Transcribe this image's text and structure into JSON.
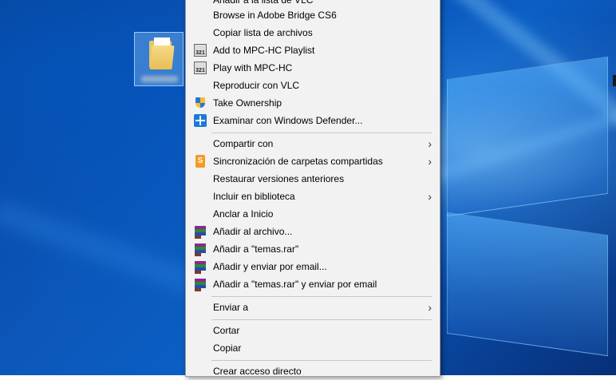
{
  "desktop": {
    "folder_icon": "folder-icon"
  },
  "menu": {
    "items": [
      {
        "label": "Añadir a la lista de VLC",
        "icon": "vlc-icon"
      },
      {
        "label": "Browse in Adobe Bridge CS6",
        "icon": ""
      },
      {
        "label": "Copiar lista de archivos",
        "icon": ""
      },
      {
        "label": "Add to MPC-HC Playlist",
        "icon": "mpc-hc-icon"
      },
      {
        "label": "Play with MPC-HC",
        "icon": "mpc-hc-icon"
      },
      {
        "label": "Reproducir con VLC",
        "icon": ""
      },
      {
        "label": "Take Ownership",
        "icon": "uac-shield-icon"
      },
      {
        "label": "Examinar con Windows Defender...",
        "icon": "windows-defender-icon"
      },
      {
        "label": "Compartir con",
        "icon": "",
        "submenu": true
      },
      {
        "label": "Sincronización de carpetas compartidas",
        "icon": "sync-icon",
        "submenu": true
      },
      {
        "label": "Restaurar versiones anteriores",
        "icon": ""
      },
      {
        "label": "Incluir en biblioteca",
        "icon": "",
        "submenu": true
      },
      {
        "label": "Anclar a Inicio",
        "icon": ""
      },
      {
        "label": "Añadir al archivo...",
        "icon": "winrar-icon"
      },
      {
        "label": "Añadir a \"temas.rar\"",
        "icon": "winrar-icon"
      },
      {
        "label": "Añadir y enviar por email...",
        "icon": "winrar-icon"
      },
      {
        "label": "Añadir a \"temas.rar\" y enviar por email",
        "icon": "winrar-icon"
      },
      {
        "label": "Enviar a",
        "icon": "",
        "submenu": true
      },
      {
        "label": "Cortar",
        "icon": ""
      },
      {
        "label": "Copiar",
        "icon": ""
      },
      {
        "label": "Crear acceso directo",
        "icon": ""
      }
    ],
    "submenu_arrow": "›"
  }
}
